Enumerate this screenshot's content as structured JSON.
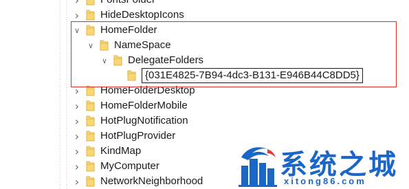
{
  "tree": {
    "nodes": [
      {
        "label": "FontsFolder",
        "level": 0,
        "expander": "collapsed"
      },
      {
        "label": "HideDesktopIcons",
        "level": 0,
        "expander": "collapsed"
      },
      {
        "label": "HomeFolder",
        "level": 0,
        "expander": "expanded"
      },
      {
        "label": "NameSpace",
        "level": 1,
        "expander": "expanded"
      },
      {
        "label": "DelegateFolders",
        "level": 2,
        "expander": "expanded"
      },
      {
        "label": "{031E4825-7B94-4dc3-B131-E946B44C8DD5}",
        "level": 3,
        "expander": "none",
        "editing": true
      },
      {
        "label": "HomeFolderDesktop",
        "level": 0,
        "expander": "collapsed"
      },
      {
        "label": "HomeFolderMobile",
        "level": 0,
        "expander": "collapsed"
      },
      {
        "label": "HotPlugNotification",
        "level": 0,
        "expander": "collapsed"
      },
      {
        "label": "HotPlugProvider",
        "level": 0,
        "expander": "collapsed"
      },
      {
        "label": "KindMap",
        "level": 0,
        "expander": "collapsed"
      },
      {
        "label": "MyComputer",
        "level": 0,
        "expander": "collapsed"
      },
      {
        "label": "NetworkNeighborhood",
        "level": 0,
        "expander": "collapsed"
      }
    ]
  },
  "watermark": {
    "title": "系统之城",
    "subtitle": "xitong86.com"
  },
  "colors": {
    "highlight_border": "#d93025",
    "folder_fill": "#f8d775",
    "folder_edge": "#e0b34a",
    "watermark_blue": "#1b67c9"
  }
}
